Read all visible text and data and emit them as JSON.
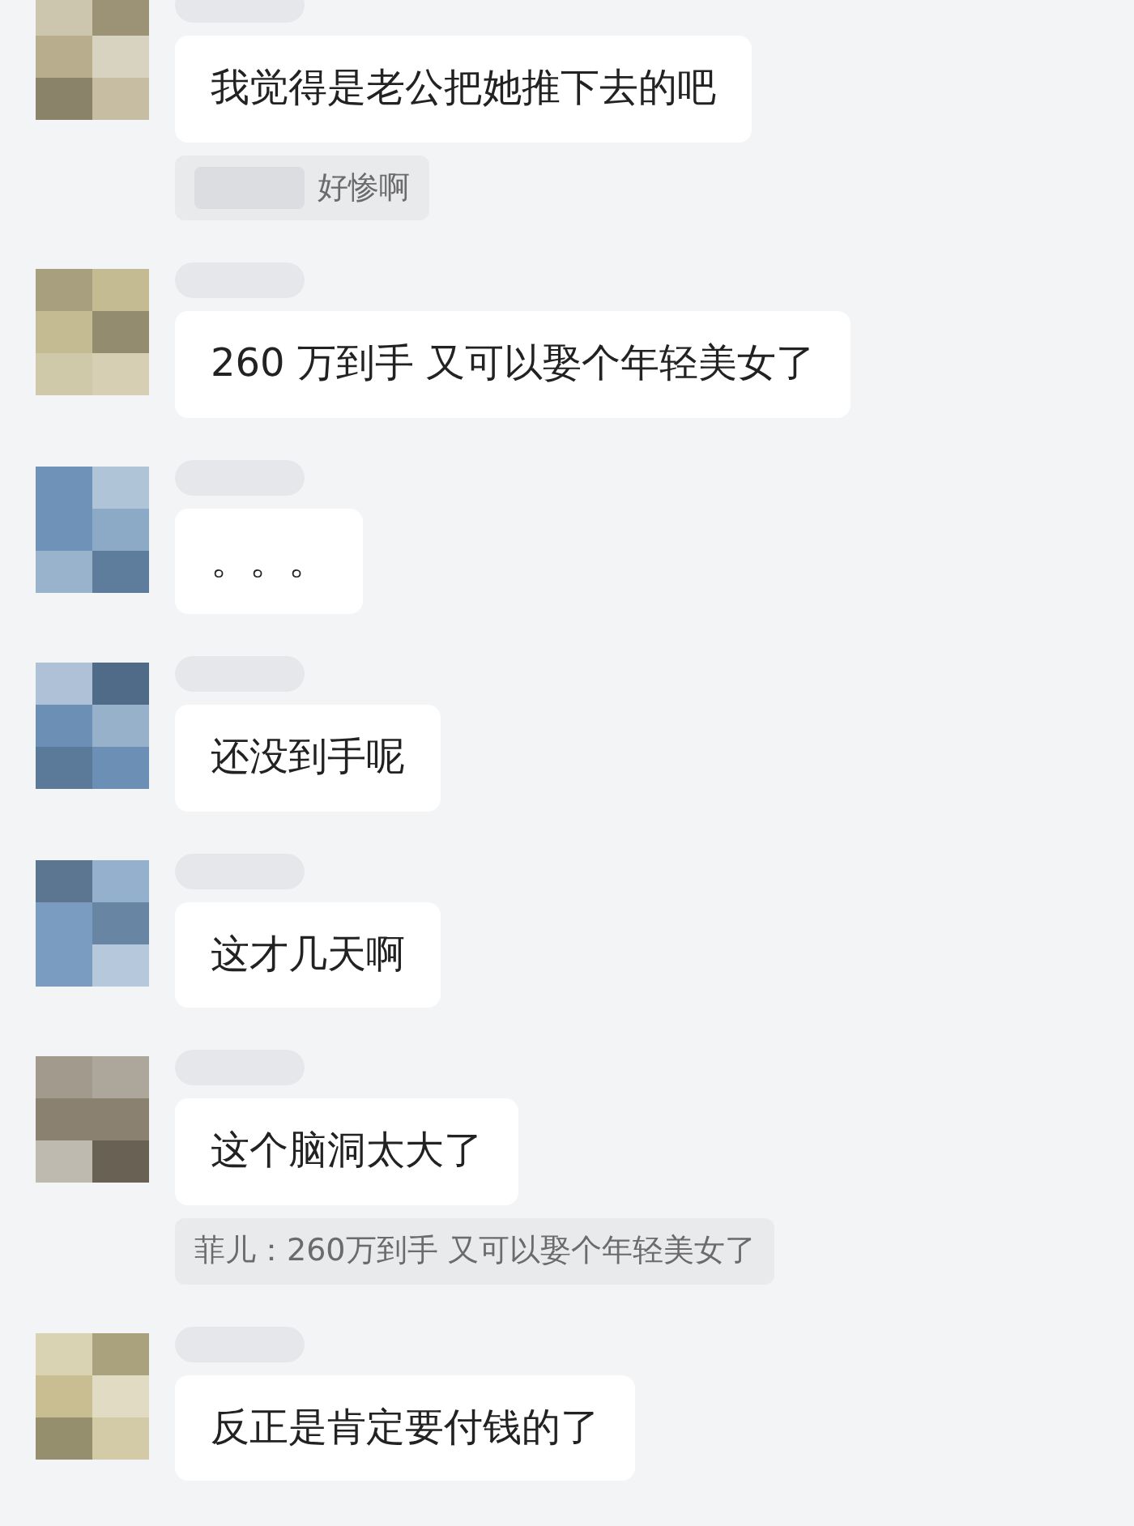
{
  "messages": [
    {
      "text": "我觉得是老公把她推下去的吧",
      "color": "#b8ad8c",
      "quote": {
        "text": "好惨啊",
        "sender_hidden": true
      }
    },
    {
      "text": "260 万到手 又可以娶个年轻美女了",
      "color": "#c4bb93"
    },
    {
      "text": "。。。",
      "color": "#6f93b8"
    },
    {
      "text": "还没到手呢",
      "color": "#6b8fb5"
    },
    {
      "text": "这才几天啊",
      "color": "#7a9cc0"
    },
    {
      "text": "这个脑洞太大了",
      "color": "#8a8170",
      "quote": {
        "text": "菲儿：260万到手 又可以娶个年轻美女了",
        "sender_hidden": false
      }
    },
    {
      "text": "反正是肯定要付钱的了",
      "color": "#c8be92"
    }
  ]
}
